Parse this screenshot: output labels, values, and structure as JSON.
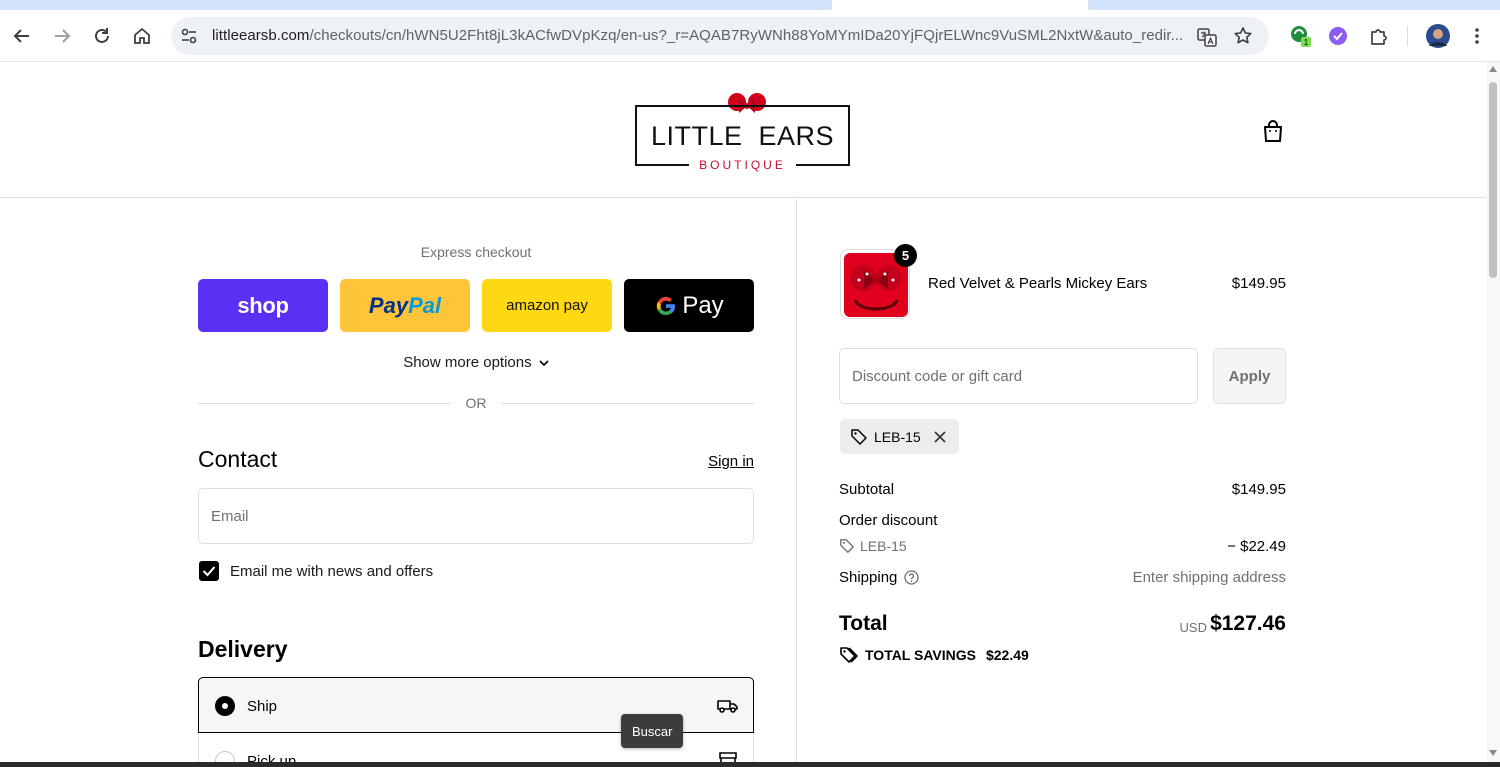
{
  "browser": {
    "url_host": "littleearsb.com",
    "url_path": "/checkouts/cn/hWN5U2Fht8jL3kACfwDVpKzq/en-us?_r=AQAB7RyWNh88YoMYmIDa20YjFQjrELWnc9VuSML2NxtW&auto_redir..."
  },
  "header": {
    "logo_title": "LITTLE  EARS",
    "logo_sub": "BOUTIQUE"
  },
  "express": {
    "label": "Express checkout",
    "shop": "shop",
    "paypal_a": "Pay",
    "paypal_b": "Pal",
    "amazon": "amazon pay",
    "gpay": "Pay",
    "more_options": "Show more options",
    "or": "OR"
  },
  "contact": {
    "heading": "Contact",
    "sign_in": "Sign in",
    "email_placeholder": "Email",
    "news_label": "Email me with news and offers",
    "news_checked": true
  },
  "delivery": {
    "heading": "Delivery",
    "options": [
      {
        "label": "Ship",
        "selected": true
      },
      {
        "label": "Pick up",
        "selected": false
      }
    ]
  },
  "tooltip": "Buscar",
  "order": {
    "product": {
      "name": "Red Velvet & Pearls Mickey Ears",
      "price": "$149.95",
      "quantity": "5"
    },
    "discount_placeholder": "Discount code or gift card",
    "apply_label": "Apply",
    "applied_code": "LEB-15",
    "subtotal_label": "Subtotal",
    "subtotal": "$149.95",
    "order_discount_label": "Order discount",
    "discount_code": "LEB-15",
    "discount_amount": "− $22.49",
    "shipping_label": "Shipping",
    "shipping_value": "Enter shipping address",
    "total_label": "Total",
    "currency": "USD",
    "total": "$127.46",
    "savings_label": "TOTAL SAVINGS",
    "savings_amount": "$22.49"
  },
  "colors": {
    "shop": "#5a31f4",
    "paypal": "#ffc439",
    "amazon": "#ffd814",
    "gpay": "#000000",
    "brand_red": "#c8102e"
  }
}
